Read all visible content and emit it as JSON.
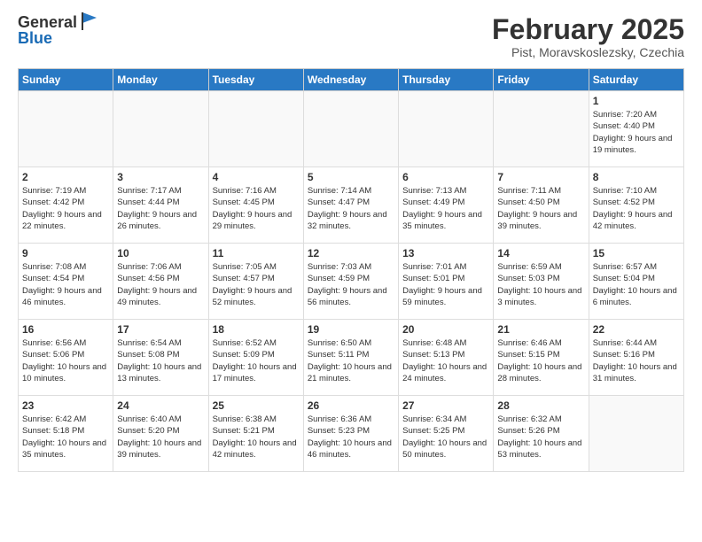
{
  "logo": {
    "general": "General",
    "blue": "Blue"
  },
  "title": "February 2025",
  "subtitle": "Pist, Moravskoslezsky, Czechia",
  "days_of_week": [
    "Sunday",
    "Monday",
    "Tuesday",
    "Wednesday",
    "Thursday",
    "Friday",
    "Saturday"
  ],
  "weeks": [
    [
      {
        "day": "",
        "info": ""
      },
      {
        "day": "",
        "info": ""
      },
      {
        "day": "",
        "info": ""
      },
      {
        "day": "",
        "info": ""
      },
      {
        "day": "",
        "info": ""
      },
      {
        "day": "",
        "info": ""
      },
      {
        "day": "1",
        "info": "Sunrise: 7:20 AM\nSunset: 4:40 PM\nDaylight: 9 hours\nand 19 minutes."
      }
    ],
    [
      {
        "day": "2",
        "info": "Sunrise: 7:19 AM\nSunset: 4:42 PM\nDaylight: 9 hours\nand 22 minutes."
      },
      {
        "day": "3",
        "info": "Sunrise: 7:17 AM\nSunset: 4:44 PM\nDaylight: 9 hours\nand 26 minutes."
      },
      {
        "day": "4",
        "info": "Sunrise: 7:16 AM\nSunset: 4:45 PM\nDaylight: 9 hours\nand 29 minutes."
      },
      {
        "day": "5",
        "info": "Sunrise: 7:14 AM\nSunset: 4:47 PM\nDaylight: 9 hours\nand 32 minutes."
      },
      {
        "day": "6",
        "info": "Sunrise: 7:13 AM\nSunset: 4:49 PM\nDaylight: 9 hours\nand 35 minutes."
      },
      {
        "day": "7",
        "info": "Sunrise: 7:11 AM\nSunset: 4:50 PM\nDaylight: 9 hours\nand 39 minutes."
      },
      {
        "day": "8",
        "info": "Sunrise: 7:10 AM\nSunset: 4:52 PM\nDaylight: 9 hours\nand 42 minutes."
      }
    ],
    [
      {
        "day": "9",
        "info": "Sunrise: 7:08 AM\nSunset: 4:54 PM\nDaylight: 9 hours\nand 46 minutes."
      },
      {
        "day": "10",
        "info": "Sunrise: 7:06 AM\nSunset: 4:56 PM\nDaylight: 9 hours\nand 49 minutes."
      },
      {
        "day": "11",
        "info": "Sunrise: 7:05 AM\nSunset: 4:57 PM\nDaylight: 9 hours\nand 52 minutes."
      },
      {
        "day": "12",
        "info": "Sunrise: 7:03 AM\nSunset: 4:59 PM\nDaylight: 9 hours\nand 56 minutes."
      },
      {
        "day": "13",
        "info": "Sunrise: 7:01 AM\nSunset: 5:01 PM\nDaylight: 9 hours\nand 59 minutes."
      },
      {
        "day": "14",
        "info": "Sunrise: 6:59 AM\nSunset: 5:03 PM\nDaylight: 10 hours\nand 3 minutes."
      },
      {
        "day": "15",
        "info": "Sunrise: 6:57 AM\nSunset: 5:04 PM\nDaylight: 10 hours\nand 6 minutes."
      }
    ],
    [
      {
        "day": "16",
        "info": "Sunrise: 6:56 AM\nSunset: 5:06 PM\nDaylight: 10 hours\nand 10 minutes."
      },
      {
        "day": "17",
        "info": "Sunrise: 6:54 AM\nSunset: 5:08 PM\nDaylight: 10 hours\nand 13 minutes."
      },
      {
        "day": "18",
        "info": "Sunrise: 6:52 AM\nSunset: 5:09 PM\nDaylight: 10 hours\nand 17 minutes."
      },
      {
        "day": "19",
        "info": "Sunrise: 6:50 AM\nSunset: 5:11 PM\nDaylight: 10 hours\nand 21 minutes."
      },
      {
        "day": "20",
        "info": "Sunrise: 6:48 AM\nSunset: 5:13 PM\nDaylight: 10 hours\nand 24 minutes."
      },
      {
        "day": "21",
        "info": "Sunrise: 6:46 AM\nSunset: 5:15 PM\nDaylight: 10 hours\nand 28 minutes."
      },
      {
        "day": "22",
        "info": "Sunrise: 6:44 AM\nSunset: 5:16 PM\nDaylight: 10 hours\nand 31 minutes."
      }
    ],
    [
      {
        "day": "23",
        "info": "Sunrise: 6:42 AM\nSunset: 5:18 PM\nDaylight: 10 hours\nand 35 minutes."
      },
      {
        "day": "24",
        "info": "Sunrise: 6:40 AM\nSunset: 5:20 PM\nDaylight: 10 hours\nand 39 minutes."
      },
      {
        "day": "25",
        "info": "Sunrise: 6:38 AM\nSunset: 5:21 PM\nDaylight: 10 hours\nand 42 minutes."
      },
      {
        "day": "26",
        "info": "Sunrise: 6:36 AM\nSunset: 5:23 PM\nDaylight: 10 hours\nand 46 minutes."
      },
      {
        "day": "27",
        "info": "Sunrise: 6:34 AM\nSunset: 5:25 PM\nDaylight: 10 hours\nand 50 minutes."
      },
      {
        "day": "28",
        "info": "Sunrise: 6:32 AM\nSunset: 5:26 PM\nDaylight: 10 hours\nand 53 minutes."
      },
      {
        "day": "",
        "info": ""
      }
    ]
  ]
}
